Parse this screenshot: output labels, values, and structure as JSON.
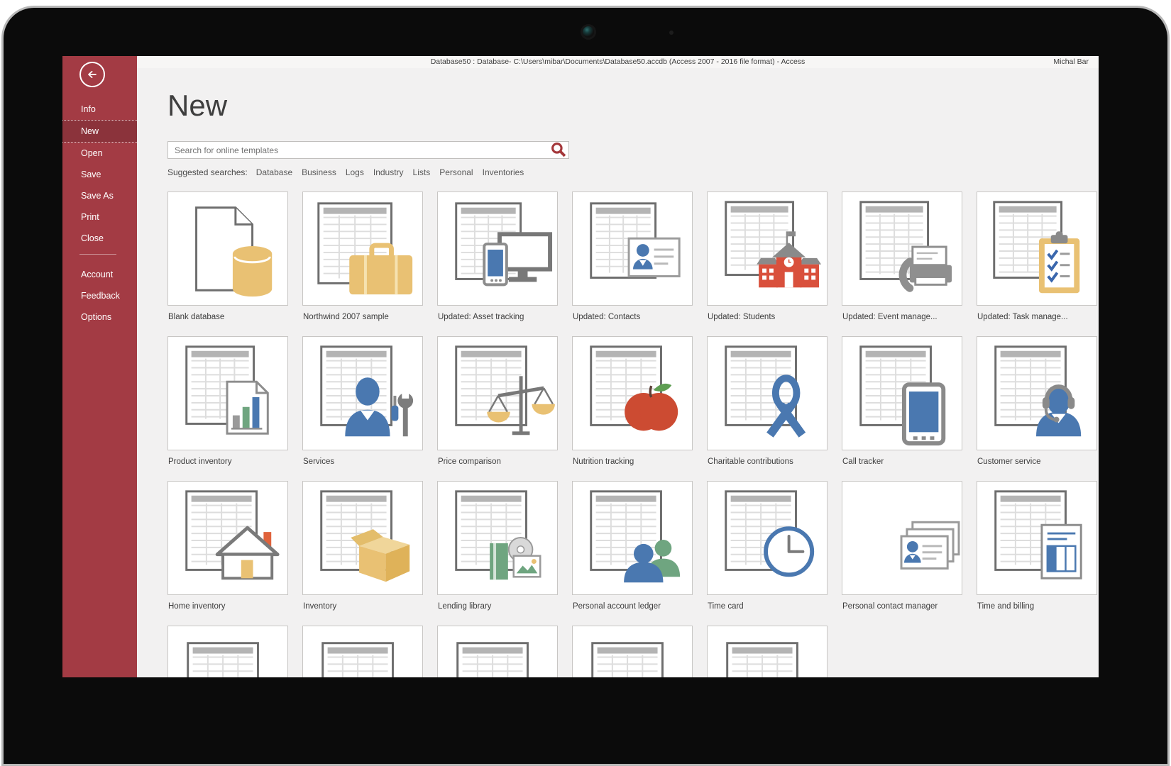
{
  "titlebar": {
    "title": "Database50 : Database- C:\\Users\\mibar\\Documents\\Database50.accdb (Access 2007 - 2016 file format) - Access",
    "user": "Michal Bar"
  },
  "sidebar": {
    "back_icon": "back-arrow-icon",
    "items": [
      {
        "label": "Info",
        "selected": false
      },
      {
        "label": "New",
        "selected": true
      },
      {
        "label": "Open",
        "selected": false
      },
      {
        "label": "Save",
        "selected": false
      },
      {
        "label": "Save As",
        "selected": false
      },
      {
        "label": "Print",
        "selected": false
      },
      {
        "label": "Close",
        "selected": false
      }
    ],
    "footer_items": [
      {
        "label": "Account"
      },
      {
        "label": "Feedback"
      },
      {
        "label": "Options"
      }
    ]
  },
  "page": {
    "title": "New"
  },
  "search": {
    "placeholder": "Search for online templates",
    "icon": "search-icon"
  },
  "suggested_searches": {
    "label": "Suggested searches:",
    "terms": [
      "Database",
      "Business",
      "Logs",
      "Industry",
      "Lists",
      "Personal",
      "Inventories"
    ]
  },
  "templates": [
    {
      "label": "Blank database",
      "icon": "blank-database-icon"
    },
    {
      "label": "Northwind 2007 sample",
      "icon": "briefcase-datasheet-icon"
    },
    {
      "label": "Updated: Asset tracking",
      "icon": "devices-datasheet-icon"
    },
    {
      "label": "Updated: Contacts",
      "icon": "contact-card-datasheet-icon"
    },
    {
      "label": "Updated: Students",
      "icon": "school-datasheet-icon"
    },
    {
      "label": "Updated: Event manage...",
      "icon": "printer-datasheet-icon"
    },
    {
      "label": "Updated: Task manage...",
      "icon": "clipboard-checks-datasheet-icon"
    },
    {
      "label": "Product inventory",
      "icon": "bar-chart-report-datasheet-icon"
    },
    {
      "label": "Services",
      "icon": "person-tools-datasheet-icon"
    },
    {
      "label": "Price comparison",
      "icon": "balance-scale-datasheet-icon"
    },
    {
      "label": "Nutrition tracking",
      "icon": "apple-datasheet-icon"
    },
    {
      "label": "Charitable contributions",
      "icon": "ribbon-datasheet-icon"
    },
    {
      "label": "Call tracker",
      "icon": "tablet-datasheet-icon"
    },
    {
      "label": "Customer service",
      "icon": "headset-person-datasheet-icon"
    },
    {
      "label": "Home inventory",
      "icon": "house-datasheet-icon"
    },
    {
      "label": "Inventory",
      "icon": "box-datasheet-icon"
    },
    {
      "label": "Lending library",
      "icon": "media-datasheet-icon"
    },
    {
      "label": "Personal account ledger",
      "icon": "two-people-datasheet-icon"
    },
    {
      "label": "Time card",
      "icon": "clock-datasheet-icon"
    },
    {
      "label": "Personal contact manager",
      "icon": "card-stack-icon"
    },
    {
      "label": "Time and billing",
      "icon": "invoice-datasheet-icon"
    }
  ],
  "partial_templates": [
    {
      "icon": "datasheet-icon"
    },
    {
      "icon": "datasheet-icon"
    },
    {
      "icon": "datasheet-lock-icon"
    },
    {
      "icon": "datasheet-icon"
    },
    {
      "icon": "datasheet-icon"
    }
  ],
  "colors": {
    "accent_red": "#a33b44",
    "accent_red_selected": "#8b333b",
    "search_icon_red": "#a4373a",
    "gold": "#e9c173",
    "blue": "#4a78b0",
    "green": "#6fa580",
    "icon_red": "#cc4b32",
    "content_bg": "#f2f1f1"
  }
}
